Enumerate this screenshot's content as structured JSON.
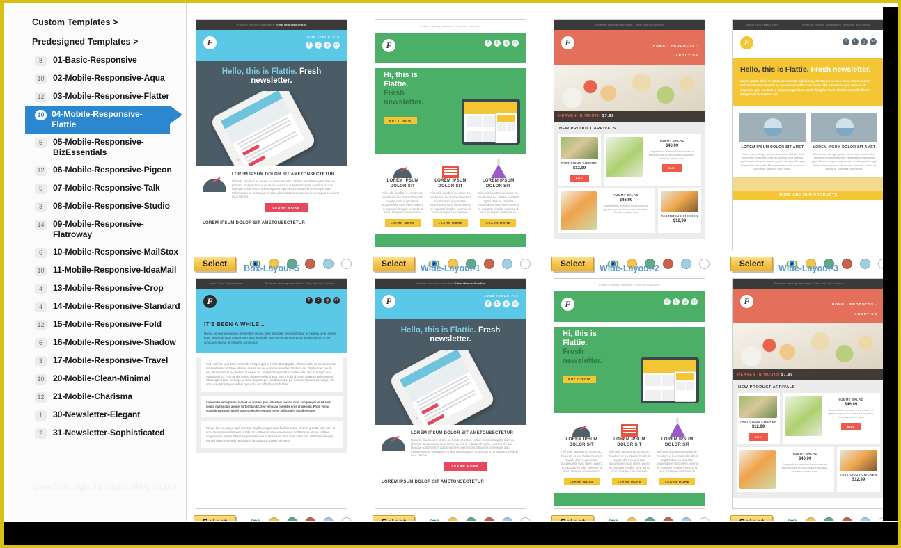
{
  "sidebar": {
    "headings": [
      {
        "label": "Custom Templates >"
      },
      {
        "label": "Predesigned Templates >"
      }
    ],
    "items": [
      {
        "count": "8",
        "label": "01-Basic-Responsive"
      },
      {
        "count": "10",
        "label": "02-Mobile-Responsive-Aqua"
      },
      {
        "count": "12",
        "label": "03-Mobile-Responsive-Flatter"
      },
      {
        "count": "10",
        "label": "04-Mobile-Responsive-Flattie"
      },
      {
        "count": "5",
        "label": "05-Mobile-Responsive-BizEssentials"
      },
      {
        "count": "12",
        "label": "06-Mobile-Responsive-Pigeon"
      },
      {
        "count": "5",
        "label": "07-Mobile-Responsive-Talk"
      },
      {
        "count": "3",
        "label": "08-Mobile-Responsive-Studio"
      },
      {
        "count": "14",
        "label": "09-Mobile-Responsive-Flatroway"
      },
      {
        "count": "6",
        "label": "10-Mobile-Responsive-MailStox"
      },
      {
        "count": "10",
        "label": "11-Mobile-Responsive-IdeaMail"
      },
      {
        "count": "4",
        "label": "13-Mobile-Responsive-Crop"
      },
      {
        "count": "4",
        "label": "14-Mobile-Responsive-Standard"
      },
      {
        "count": "12",
        "label": "15-Mobile-Responsive-Fold"
      },
      {
        "count": "6",
        "label": "16-Mobile-Responsive-Shadow"
      },
      {
        "count": "3",
        "label": "17-Mobile-Responsive-Travel"
      },
      {
        "count": "10",
        "label": "20-Mobile-Clean-Minimal"
      },
      {
        "count": "12",
        "label": "21-Mobile-Charisma"
      },
      {
        "count": "1",
        "label": "30-Newsletter-Elegant"
      },
      {
        "count": "2",
        "label": "31-Newsletter-Sophisticated"
      }
    ],
    "selected_index": 3,
    "watermark": "www.heritagechristiancollege.com"
  },
  "actions": {
    "select_label": "Select",
    "preview_icon": "eye-icon",
    "swatch_colors": [
      "#f0c64c",
      "#62a98a",
      "#c8624d",
      "#9fcfe0",
      "#ffffff"
    ]
  },
  "templates": [
    {
      "title": "",
      "preheader": "Problem viewing newsletter?",
      "preheader_link": "View this mail online",
      "issue": "JUNE ISSUE #10",
      "headline_soft": "Hello, this is Flattie.",
      "headline_hard": "Fresh newsletter.",
      "section_title": "LOREM IPSUM DOLOR SIT AMETONSECTETUR",
      "section_body": "Nisl velit, faucibus eu ornare ac, hendrerit et leo. Nullam hendrerit sagittis diam eu pharetra. Suspendisse nunc lorem, viverra in vulputate fringilla, euismod id risus. Quisque condimentum adipiscing sem eget tempor. Mauris id scelerisque odio. Pellentesque ut velit augue. Nullam placerat dolor sit amet urna consequat a eleifend risus semper.",
      "cta": "LEARN MORE",
      "footer_title": "LOREM IPSUM DOLOR SIT AMETONSECTETUR"
    },
    {
      "title": "",
      "preheader": "Problem viewing newsletter? View this mail online",
      "headline_1": "Hi, this is",
      "headline_2": "Flattie.",
      "headline_3": "Fresh",
      "headline_4": "newsletter.",
      "cta": "BUY IT NOW",
      "columns": [
        {
          "title": "LOREM IPSUM DOLOR SIT",
          "body": "Nisl velit, faucibus eu ornare ac, hendrerit et leo. Nullam hendrerit sagittis diam eu pharetra. Suspendisse nunc lorem, viverra in vulputate fringilla, euismod id risus. Quisque condimentum.",
          "cta": "LEARN MORE"
        },
        {
          "title": "LOREM IPSUM DOLOR SIT",
          "body": "Nisl velit, faucibus eu ornare ac, hendrerit et leo. Nullam hendrerit sagittis diam eu pharetra. Suspendisse nunc lorem, viverra in vulputate fringilla, euismod id risus. Quisque condimentum.",
          "cta": "LEARN MORE"
        },
        {
          "title": "LOREM IPSUM DOLOR SIT",
          "body": "Nisl velit, faucibus eu ornare ac, hendrerit et leo. Nullam hendrerit sagittis diam eu pharetra. Suspendisse nunc lorem, viverra in vulputate fringilla, euismod id risus. Quisque condimentum.",
          "cta": "LEARN MORE"
        }
      ]
    },
    {
      "title": "",
      "preheader": "Problem viewing newsletter? View this mail online",
      "nav": [
        "HOME  ·",
        "PRODUCTS  ·",
        "ABOUT US"
      ],
      "feature_name": "HEAVEN IN MOUTH",
      "feature_price": "$7.99",
      "arrivals_title": "NEW PRODUCT ARRIVALS",
      "products": [
        {
          "name": "TASTICIOUS CHICKEN",
          "price": "$12,99",
          "cta": "BUY"
        },
        {
          "name": "YUMMY SALAD",
          "price": "$46,99",
          "desc": "Suspendisse interdum ris sit amet est egestas eget pulvinar mauris faucibus. Vivamus sapien eros.",
          "cta": "BUY"
        },
        {
          "name": "YUMMY SALAD",
          "price": "$46,99",
          "desc": "Suspendisse interdum ris sit amet est egestas eget pulvinar mauris faucibus. Vivamus sapien eros."
        },
        {
          "name": "TASTICIOUS CHICKEN",
          "price": "$12,99"
        }
      ]
    },
    {
      "title": "",
      "preheader_left": "Insert Your Teaser Here",
      "preheader_right": "Problem viewing newsletter? View this mail online",
      "headline_dark": "Hello, this is Flattie.",
      "headline_light": "Fresh newsletter.",
      "body": "Lorem ipsum dolor sit amet, consectetur adipiscing elit. Mauris ac felis nunc. Vivamus ante nisl, tincidunt ut lobortis et, laoreet non nibh. Cras libero felis, venenatis quis ultrices id, vulputate quis est. Donec ac purus eget diam mattis fringilla. Nunc lobortis convallis libero, integer sed fermentum nisl.",
      "cards": [
        {
          "title": "LOREM IPSUM DOLOR SIT AMET",
          "body": "Donec non elit eget ipsum elementum lacinia. Sed imperdiet imperdiet tortor, et facilisis urna facilisis eget. Mauris tempus magna eget urna imperdiet eget fermentum nisi porta. Maecenas arcu nisi, conue at lacinia ut, pharetra non neque."
        },
        {
          "title": "LOREM IPSUM DOLOR SIT AMET",
          "body": "Donec non elit eget ipsum elementum lacinia. Sed imperdiet imperdiet tortor, et facilisis urna facilisis eget. Mauris tempus magna eget urna imperdiet eget fermentum nisi porta. Maecenas arcu nisi, conue at lacinia ut, pharetra non neque."
        }
      ],
      "footer_band": "HERE ARE OUR PRODUCTS"
    },
    {
      "title": "Box-Layout-5",
      "preheader_left": "Insert Your Teaser Here",
      "preheader_right": "Problem viewing newsletter? View this mail online",
      "headline": "IT'S BEEN A WHILE ..",
      "intro": "Donec non elit eget ipsum elementum lacinia. Sed imperdiet imperdiet tortor, et facilisis urna facilisis eget. Mauris tempus magna eget urna imperdiet eget fermentum nisi porta. Maecenas arcu nisi, congue at lacinia ut, pharetra non neque.",
      "block_1": "Sed non felis eget dolor commodo tristique quis vel nulla. Duis dapibus ultrices nulla, sit amet euismod ipsum eleifend ut. Proin sit amet sem ut mauris euismod imperdiet. Ut libero est, dapibus nec iaculis nec, fermentum et leo. Nullam at neque dui. Suspendisse interdum malesuada urna, id tempor urna malesuada eu. Proin at nisi purus, sit amet eleifend arcu. Sed a nulla id metus pharetra pellentesque. Class aptent taciti sociosqu ad litora torquent per conubia nostra, per inceptos himenaeos. Integer sit amet volutpat magna. Nullam quis dolor vel nibh pharetra facilisis.",
      "block_2": "Suspendisse turpis mi, laoreet eu rutrum quis, interdum nec mi. Cras congue ipsum sit amet ipsum mattis quis aliquet tortor blandit. Sed vehicula molestie eros id pretium. Proin varius suscipit euismod. Morbi placerat est fermentum lorem sollicitudin condimentum.",
      "block_3": "Integer laoreet, augue quis convallis fringilla, magna dolor facilisis purus, sit amet gravida nibh nunc et arcu. Duis posuere fermentum felis, at sodales est vehicula vehicula. Sed tristique ornare sodales. Suspendisse potenti. Phasellus porta fermentum bibendum. In sit amet tortor nisi. Vestibulum feugiat est sed quam venenatis nec ultrices lectus luctus. Donec vel auctor"
    },
    {
      "title": "Wide-Layout-1",
      "preheader": "Problem viewing newsletter?",
      "preheader_link": "View this mail online",
      "issue": "JUNE ISSUE #10",
      "headline_soft": "Hello, this is Flattie.",
      "headline_hard": "Fresh newsletter.",
      "section_title": "LOREM IPSUM DOLOR SIT AMETONSECTETUR",
      "section_body": "Nisl velit, faucibus eu ornare ac, hendrerit et leo. Nullam hendrerit sagittis diam eu pharetra. Suspendisse nunc lorem, viverra in vulputate fringilla, euismod id risus. Quisque condimentum adipiscing sem eget tempor. Mauris id scelerisque odio. Pellentesque ut velit augue. Nullam placerat dolor sit amet urna consequat a eleifend risus semper.",
      "cta": "LEARN MORE",
      "footer_title": "LOREM IPSUM DOLOR SIT AMETONSECTETUR"
    },
    {
      "title": "Wide-Layout-2",
      "preheader": "Problem viewing newsletter? View this mail online",
      "headline_1": "Hi, this is",
      "headline_2": "Flattie.",
      "headline_3": "Fresh",
      "headline_4": "newsletter.",
      "cta": "BUY IT NOW",
      "columns": [
        {
          "title": "LOREM IPSUM DOLOR SIT",
          "body": "Nisl velit, faucibus eu ornare ac, hendrerit et leo. Nullam he drerit sagittis diam eu pharetra. Suspendisse nunc lorem, viverra in vulputate fringilla, euismod id risus. Quisque condimentum.",
          "cta": "LEARN MORE"
        },
        {
          "title": "LOREM IPSUM DOLOR SIT",
          "body": "Nisl velit, faucibus eu ornare ac, hendrerit et leo. Nullam he drerit sagittis diam eu pharetra. Suspendisse nunc lorem, viverra in vulputate fringilla, euismod id risus. Quisque condimentum.",
          "cta": "LEARN MORE"
        },
        {
          "title": "LOREM IPSUM DOLOR SIT",
          "body": "Nisl velit, faucibus eu ornare ac, hendrerit et leo. Nullam he drerit sagittis diam eu pharetra. Suspendisse nunc lorem, viverra in vulputate fringilla, euismod id risus. Quisque condimentum.",
          "cta": "LEARN MORE"
        }
      ]
    },
    {
      "title": "Wide-Layout-3",
      "preheader": "Problem viewing newsletter? View this mail online",
      "nav": [
        "HOME  ·",
        "PRODUCTS  ·",
        "ABOUT US"
      ],
      "feature_name": "HEAVEN IN MOUTH",
      "feature_price": "$7.99",
      "arrivals_title": "NEW PRODUCT ARRIVALS",
      "products": [
        {
          "name": "TASTICIOUS CHICKEN",
          "price": "$12,99",
          "cta": "BUY"
        },
        {
          "name": "YUMMY SALAD",
          "price": "$46,99",
          "desc": "Suspendisse interdum ris sit amet est egestas eget pulvinar mauris faucibus. Vivamus sapien eros.",
          "cta": "BUY"
        },
        {
          "name": "YUMMY SALAD",
          "price": "$46,99",
          "desc": "Suspendisse interdum ris sit amet est egestas eget pulvinar mauris faucibus. Vivamus sapien eros."
        },
        {
          "name": "TASTICIOUS CHICKEN",
          "price": "$12,99"
        }
      ]
    }
  ]
}
